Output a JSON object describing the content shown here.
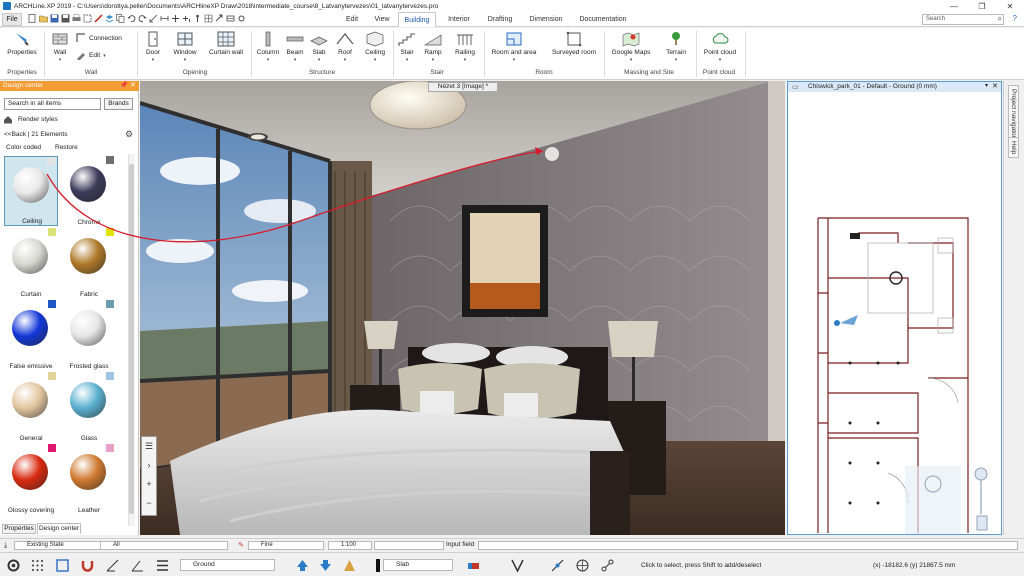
{
  "window": {
    "title": "ARCHLine.XP 2019 - C:\\Users\\dorottya.peller\\Documents\\ARCHlineXP Draw\\2018\\intermediate_course\\8_Latvanytervezes\\01_latvanytervezes.pro",
    "minimize": "—",
    "restore": "❐",
    "close": "✕"
  },
  "tabs": {
    "file": "File",
    "items": [
      "Edit",
      "View",
      "Building",
      "Interior",
      "Drafting",
      "Dimension",
      "Documentation"
    ],
    "active": "Building"
  },
  "search": {
    "placeholder": "Search"
  },
  "ribbon": {
    "properties": "Properties",
    "wall": "Wall",
    "connection": "Connection",
    "edit": "Edit",
    "door": "Door",
    "window": "Window",
    "curtain_wall": "Curtain wall",
    "column": "Column",
    "beam": "Beam",
    "slab": "Slab",
    "roof": "Roof",
    "ceiling": "Ceiling",
    "stair": "Stair",
    "ramp": "Ramp",
    "railing": "Railing",
    "room_and_area": "Room and area",
    "surveyed_room": "Surveyed room",
    "google_maps": "Google Maps",
    "terrain": "Terrain",
    "point_cloud": "Point cloud",
    "groups": [
      "Properties",
      "Wall",
      "Opening",
      "Structure",
      "Stair",
      "Room",
      "Massing and Site",
      "Point cloud"
    ]
  },
  "design_center": {
    "title": "Design center",
    "pin": "📌",
    "close": "✕",
    "search_placeholder": "Search in all items",
    "brands": "Brands",
    "breadcrumb": "Render styles",
    "back": "<<Back",
    "count": "21 Elements",
    "color_coded": "Color coded",
    "restore": "Restore",
    "materials": [
      {
        "name": "Ceiling",
        "swatch": "#e3e3e3",
        "ball": "#e8e8e8"
      },
      {
        "name": "Chrome",
        "swatch": "#6e6e6e",
        "ball": "#3e3a5a"
      },
      {
        "name": "Curtain",
        "swatch": "#d9e37a",
        "ball": "#d8d8d2"
      },
      {
        "name": "Fabric",
        "swatch": "#e4e40a",
        "ball": "#b07a2a"
      },
      {
        "name": "False emissive",
        "swatch": "#1f56c8",
        "ball": "#1438d8"
      },
      {
        "name": "Frosted glass",
        "swatch": "#6b9cb0",
        "ball": "#e6e6e6"
      },
      {
        "name": "General",
        "swatch": "#e0d49a",
        "ball": "#e2c6a0"
      },
      {
        "name": "Glass",
        "swatch": "#9fc4e6",
        "ball": "#5bb0d0"
      },
      {
        "name": "Glossy covering",
        "swatch": "#e01870",
        "ball": "#d82a10"
      },
      {
        "name": "Leather",
        "swatch": "#e8a0c8",
        "ball": "#d07a30"
      }
    ]
  },
  "panel_tabs": {
    "properties": "Properties",
    "design_center": "Design center"
  },
  "view3d": {
    "label": "Nézet 3 [Image] *"
  },
  "plan": {
    "title": "Chiswick_park_01 - Default - Ground (0 mm)"
  },
  "vertical_tabs": [
    "Project navigator",
    "Help"
  ],
  "bottom": {
    "state": "Existing State",
    "filter": "All",
    "quality": "Fine",
    "scale": "1:100",
    "input_label": "Input field",
    "layer": "Ground",
    "slab": "Slab",
    "status": "Click to select, press Shift to add/deselect",
    "coords": "(x) -18182.6  (y) 21867.5 mm"
  }
}
